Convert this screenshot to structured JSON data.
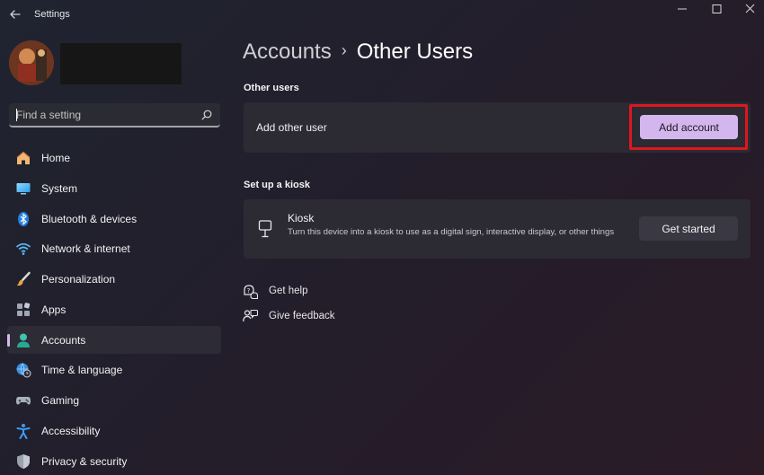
{
  "window": {
    "title": "Settings"
  },
  "search": {
    "placeholder": "Find a setting"
  },
  "sidebar": {
    "items": [
      {
        "label": "Home",
        "icon": "home-icon"
      },
      {
        "label": "System",
        "icon": "system-icon"
      },
      {
        "label": "Bluetooth & devices",
        "icon": "bluetooth-icon"
      },
      {
        "label": "Network & internet",
        "icon": "wifi-icon"
      },
      {
        "label": "Personalization",
        "icon": "brush-icon"
      },
      {
        "label": "Apps",
        "icon": "apps-icon"
      },
      {
        "label": "Accounts",
        "icon": "accounts-icon",
        "selected": true
      },
      {
        "label": "Time & language",
        "icon": "globe-clock-icon"
      },
      {
        "label": "Gaming",
        "icon": "gamepad-icon"
      },
      {
        "label": "Accessibility",
        "icon": "accessibility-icon"
      },
      {
        "label": "Privacy & security",
        "icon": "shield-icon"
      }
    ]
  },
  "breadcrumb": {
    "parent": "Accounts",
    "separator": "›",
    "current": "Other Users"
  },
  "other_users": {
    "heading": "Other users",
    "add_label": "Add other user",
    "add_button": "Add account"
  },
  "kiosk": {
    "heading": "Set up a kiosk",
    "title": "Kiosk",
    "description": "Turn this device into a kiosk to use as a digital sign, interactive display, or other things",
    "button": "Get started"
  },
  "links": {
    "help": "Get help",
    "feedback": "Give feedback"
  },
  "colors": {
    "accent": "#d4b6ee",
    "highlight": "#e0161e",
    "card": "#2c2a33"
  }
}
